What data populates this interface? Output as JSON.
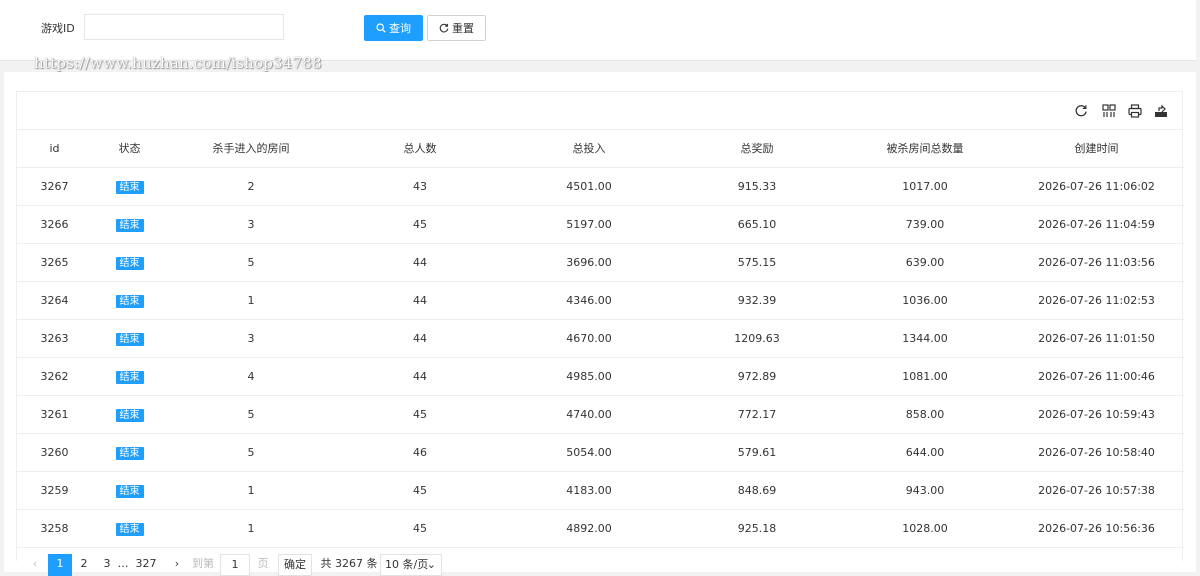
{
  "search": {
    "label": "游戏ID",
    "value": "",
    "query_label": "查询",
    "reset_label": "重置"
  },
  "watermark": "https://www.huzhan.com/ishop34788",
  "toolbar_icons": [
    "refresh-icon",
    "columns-icon",
    "print-icon",
    "export-icon"
  ],
  "table": {
    "headers": [
      "id",
      "状态",
      "杀手进入的房间",
      "总人数",
      "总投入",
      "总奖励",
      "被杀房间总数量",
      "创建时间"
    ],
    "rows": [
      {
        "id": "3267",
        "status": "结束",
        "room": "2",
        "people": "43",
        "input": "4501.00",
        "reward": "915.33",
        "killed": "1017.00",
        "time": "2026-07-26 11:06:02"
      },
      {
        "id": "3266",
        "status": "结束",
        "room": "3",
        "people": "45",
        "input": "5197.00",
        "reward": "665.10",
        "killed": "739.00",
        "time": "2026-07-26 11:04:59"
      },
      {
        "id": "3265",
        "status": "结束",
        "room": "5",
        "people": "44",
        "input": "3696.00",
        "reward": "575.15",
        "killed": "639.00",
        "time": "2026-07-26 11:03:56"
      },
      {
        "id": "3264",
        "status": "结束",
        "room": "1",
        "people": "44",
        "input": "4346.00",
        "reward": "932.39",
        "killed": "1036.00",
        "time": "2026-07-26 11:02:53"
      },
      {
        "id": "3263",
        "status": "结束",
        "room": "3",
        "people": "44",
        "input": "4670.00",
        "reward": "1209.63",
        "killed": "1344.00",
        "time": "2026-07-26 11:01:50"
      },
      {
        "id": "3262",
        "status": "结束",
        "room": "4",
        "people": "44",
        "input": "4985.00",
        "reward": "972.89",
        "killed": "1081.00",
        "time": "2026-07-26 11:00:46"
      },
      {
        "id": "3261",
        "status": "结束",
        "room": "5",
        "people": "45",
        "input": "4740.00",
        "reward": "772.17",
        "killed": "858.00",
        "time": "2026-07-26 10:59:43"
      },
      {
        "id": "3260",
        "status": "结束",
        "room": "5",
        "people": "46",
        "input": "5054.00",
        "reward": "579.61",
        "killed": "644.00",
        "time": "2026-07-26 10:58:40"
      },
      {
        "id": "3259",
        "status": "结束",
        "room": "1",
        "people": "45",
        "input": "4183.00",
        "reward": "848.69",
        "killed": "943.00",
        "time": "2026-07-26 10:57:38"
      },
      {
        "id": "3258",
        "status": "结束",
        "room": "1",
        "people": "45",
        "input": "4892.00",
        "reward": "925.18",
        "killed": "1028.00",
        "time": "2026-07-26 10:56:36"
      }
    ]
  },
  "pager": {
    "prev": "‹",
    "pages": [
      "1",
      "2",
      "3"
    ],
    "ellipsis": "…",
    "last": "327",
    "next": "›",
    "goto_prefix": "到第",
    "goto_value": "1",
    "goto_suffix": "页",
    "confirm": "确定",
    "total": "共 3267 条",
    "page_size": "10 条/页"
  },
  "colors": {
    "accent": "#1e9fff",
    "border": "#eeeeee",
    "background": "#f2f2f2"
  }
}
